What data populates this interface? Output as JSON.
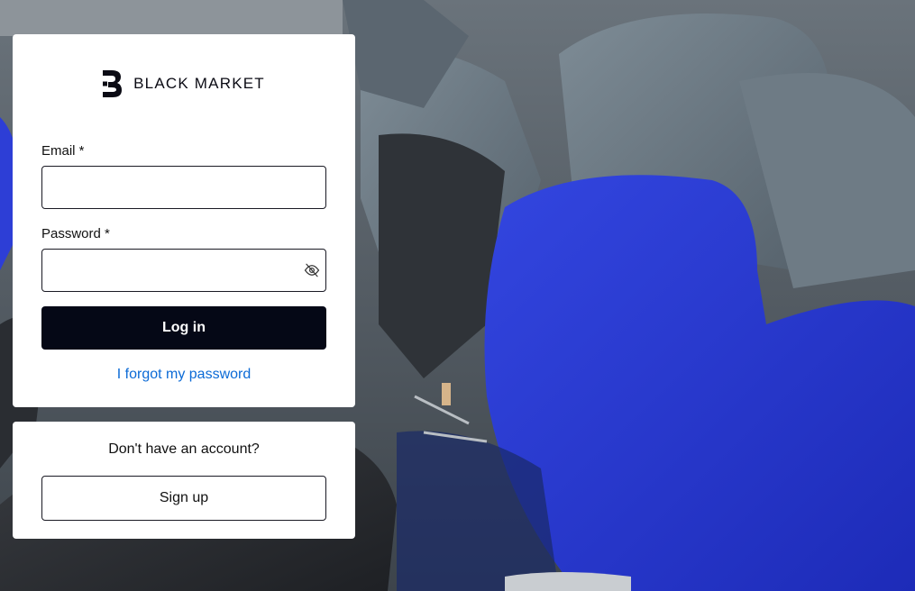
{
  "brand": {
    "name": "BLACK MARKET",
    "logo_icon": "black-market-logo-icon"
  },
  "login": {
    "email_label": "Email *",
    "email_value": "",
    "password_label": "Password *",
    "password_value": "",
    "password_toggle_icon": "eye-off-icon",
    "submit_label": "Log in",
    "forgot_label": "I forgot my password"
  },
  "signup": {
    "prompt": "Don't have an account?",
    "button_label": "Sign up"
  },
  "colors": {
    "primary_button": "#050816",
    "link": "#0b6ad6",
    "card_background": "#ffffff",
    "accent_chair": "#2a3bd6"
  }
}
